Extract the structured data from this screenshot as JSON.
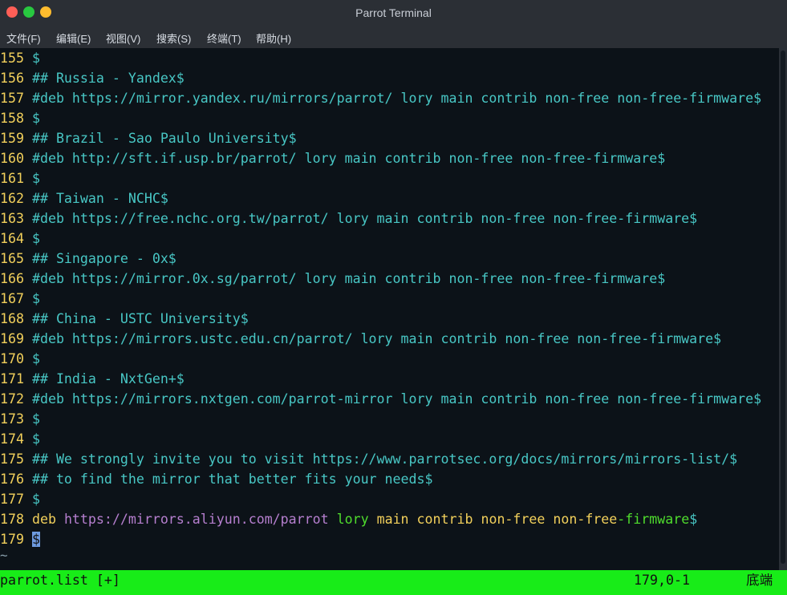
{
  "window": {
    "title": "Parrot Terminal"
  },
  "menu": [
    {
      "label": "文件(F)"
    },
    {
      "label": "编辑(E)"
    },
    {
      "label": "视图(V)"
    },
    {
      "label": "搜索(S)"
    },
    {
      "label": "终端(T)"
    },
    {
      "label": "帮助(H)"
    }
  ],
  "lines": [
    {
      "num": "155",
      "segments": [
        {
          "text": "$",
          "color": "cyan"
        }
      ]
    },
    {
      "num": "156",
      "segments": [
        {
          "text": "## Russia - Yandex$",
          "color": "cyan"
        }
      ]
    },
    {
      "num": "157",
      "segments": [
        {
          "text": "#deb https://mirror.yandex.ru/mirrors/parrot/ lory main contrib non-free non-free-firmware$",
          "color": "cyan"
        }
      ]
    },
    {
      "num": "158",
      "segments": [
        {
          "text": "$",
          "color": "cyan"
        }
      ]
    },
    {
      "num": "159",
      "segments": [
        {
          "text": "## Brazil - Sao Paulo University$",
          "color": "cyan"
        }
      ]
    },
    {
      "num": "160",
      "segments": [
        {
          "text": "#deb http://sft.if.usp.br/parrot/ lory main contrib non-free non-free-firmware$",
          "color": "cyan"
        }
      ]
    },
    {
      "num": "161",
      "segments": [
        {
          "text": "$",
          "color": "cyan"
        }
      ]
    },
    {
      "num": "162",
      "segments": [
        {
          "text": "## Taiwan - NCHC$",
          "color": "cyan"
        }
      ]
    },
    {
      "num": "163",
      "segments": [
        {
          "text": "#deb https://free.nchc.org.tw/parrot/ lory main contrib non-free non-free-firmware$",
          "color": "cyan"
        }
      ]
    },
    {
      "num": "164",
      "segments": [
        {
          "text": "$",
          "color": "cyan"
        }
      ]
    },
    {
      "num": "165",
      "segments": [
        {
          "text": "## Singapore - 0x$",
          "color": "cyan"
        }
      ]
    },
    {
      "num": "166",
      "segments": [
        {
          "text": "#deb https://mirror.0x.sg/parrot/ lory main contrib non-free non-free-firmware$",
          "color": "cyan"
        }
      ]
    },
    {
      "num": "167",
      "segments": [
        {
          "text": "$",
          "color": "cyan"
        }
      ]
    },
    {
      "num": "168",
      "segments": [
        {
          "text": "## China - USTC University$",
          "color": "cyan"
        }
      ]
    },
    {
      "num": "169",
      "segments": [
        {
          "text": "#deb https://mirrors.ustc.edu.cn/parrot/ lory main contrib non-free non-free-firmware$",
          "color": "cyan"
        }
      ]
    },
    {
      "num": "170",
      "segments": [
        {
          "text": "$",
          "color": "cyan"
        }
      ]
    },
    {
      "num": "171",
      "segments": [
        {
          "text": "## India - NxtGen+$",
          "color": "cyan"
        }
      ]
    },
    {
      "num": "172",
      "segments": [
        {
          "text": "#deb https://mirrors.nxtgen.com/parrot-mirror lory main contrib non-free non-free-firmware$",
          "color": "cyan"
        }
      ]
    },
    {
      "num": "173",
      "segments": [
        {
          "text": "$",
          "color": "cyan"
        }
      ]
    },
    {
      "num": "174",
      "segments": [
        {
          "text": "$",
          "color": "cyan"
        }
      ]
    },
    {
      "num": "175",
      "segments": [
        {
          "text": "## We strongly invite you to visit https://www.parrotsec.org/docs/mirrors/mirrors-list/$",
          "color": "cyan"
        }
      ]
    },
    {
      "num": "176",
      "segments": [
        {
          "text": "## to find the mirror that better fits your needs$",
          "color": "cyan"
        }
      ]
    },
    {
      "num": "177",
      "segments": [
        {
          "text": "$",
          "color": "cyan"
        }
      ]
    },
    {
      "num": "178",
      "segments": [
        {
          "text": "deb ",
          "color": "yellow"
        },
        {
          "text": "https://mirrors.aliyun.com/parrot",
          "color": "purple"
        },
        {
          "text": " ",
          "color": "white"
        },
        {
          "text": "lory",
          "color": "green"
        },
        {
          "text": " main contrib non-free non-free",
          "color": "yellow"
        },
        {
          "text": "-firmware",
          "color": "green"
        },
        {
          "text": "$",
          "color": "cyan"
        }
      ]
    },
    {
      "num": "179",
      "segments": [
        {
          "text": "$",
          "color": "cursor"
        }
      ]
    }
  ],
  "tilde": "~",
  "status": {
    "filename": "parrot.list [+]",
    "position": "179,0-1",
    "scroll": "底端"
  }
}
